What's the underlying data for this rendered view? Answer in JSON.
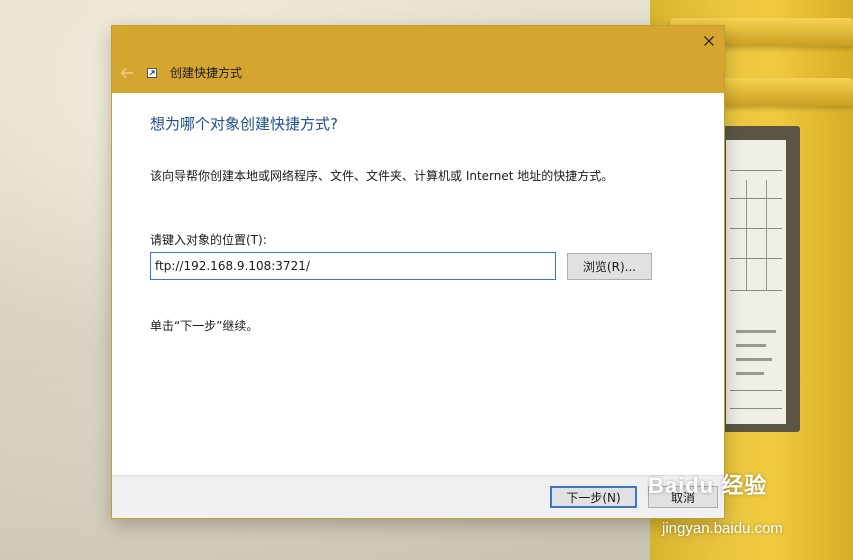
{
  "window": {
    "title": "创建快捷方式",
    "close_icon": "close-icon",
    "back_icon": "back-arrow-icon",
    "shortcut_icon": "shortcut-icon",
    "accent_color": "#d4a62f"
  },
  "page": {
    "heading": "想为哪个对象创建快捷方式?",
    "description": "该向导帮你创建本地或网络程序、文件、文件夹、计算机或 Internet 地址的快捷方式。",
    "location_label": "请键入对象的位置(T):",
    "location_value": "ftp://192.168.9.108:3721/",
    "browse_label": "浏览(R)...",
    "hint": "单击“下一步”继续。"
  },
  "footer": {
    "next_label": "下一步(N)",
    "cancel_label": "取消"
  },
  "watermark": {
    "brand": "Baidu 经验",
    "url": "jingyan.baidu.com"
  }
}
